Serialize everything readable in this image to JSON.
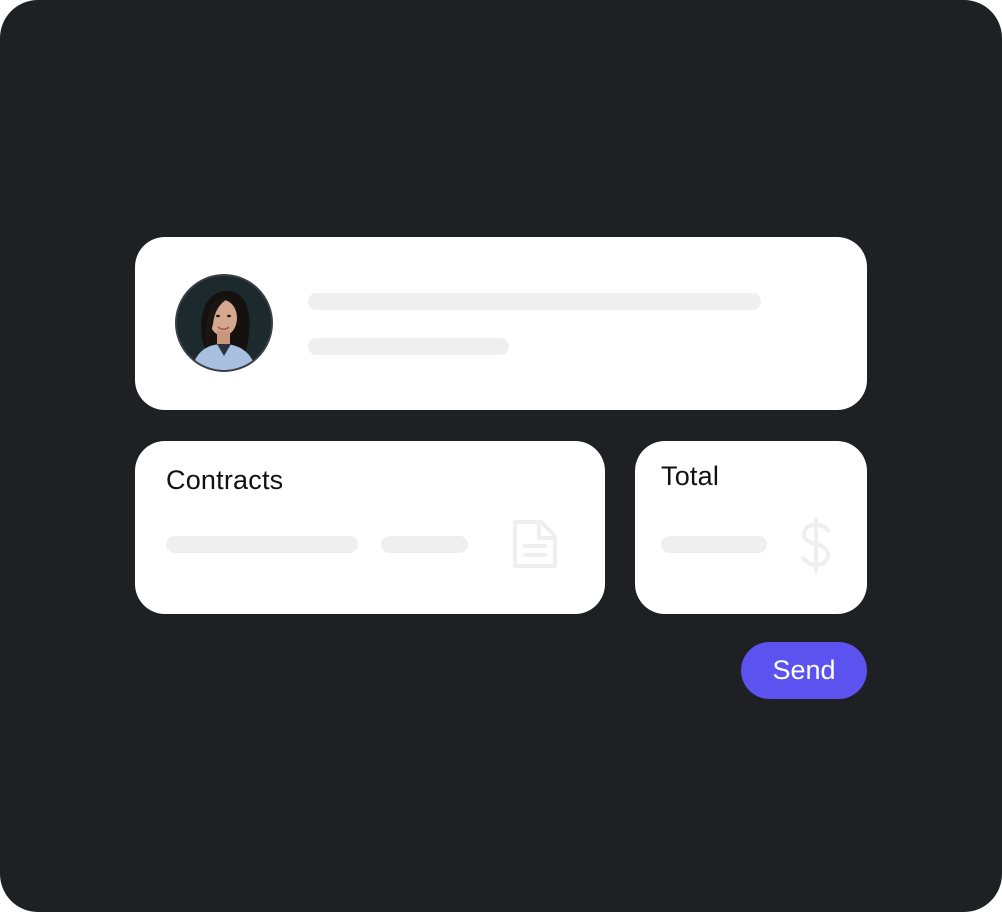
{
  "profile": {
    "avatar_icon": "user-avatar-photo"
  },
  "contracts": {
    "title": "Contracts",
    "icon": "document-icon"
  },
  "total": {
    "title": "Total",
    "icon": "dollar-icon"
  },
  "actions": {
    "send_label": "Send"
  },
  "colors": {
    "background": "#1f2023",
    "card": "#ffffff",
    "skeleton": "#efefef",
    "accent": "#5b52f0",
    "icon_muted": "#efefef"
  }
}
